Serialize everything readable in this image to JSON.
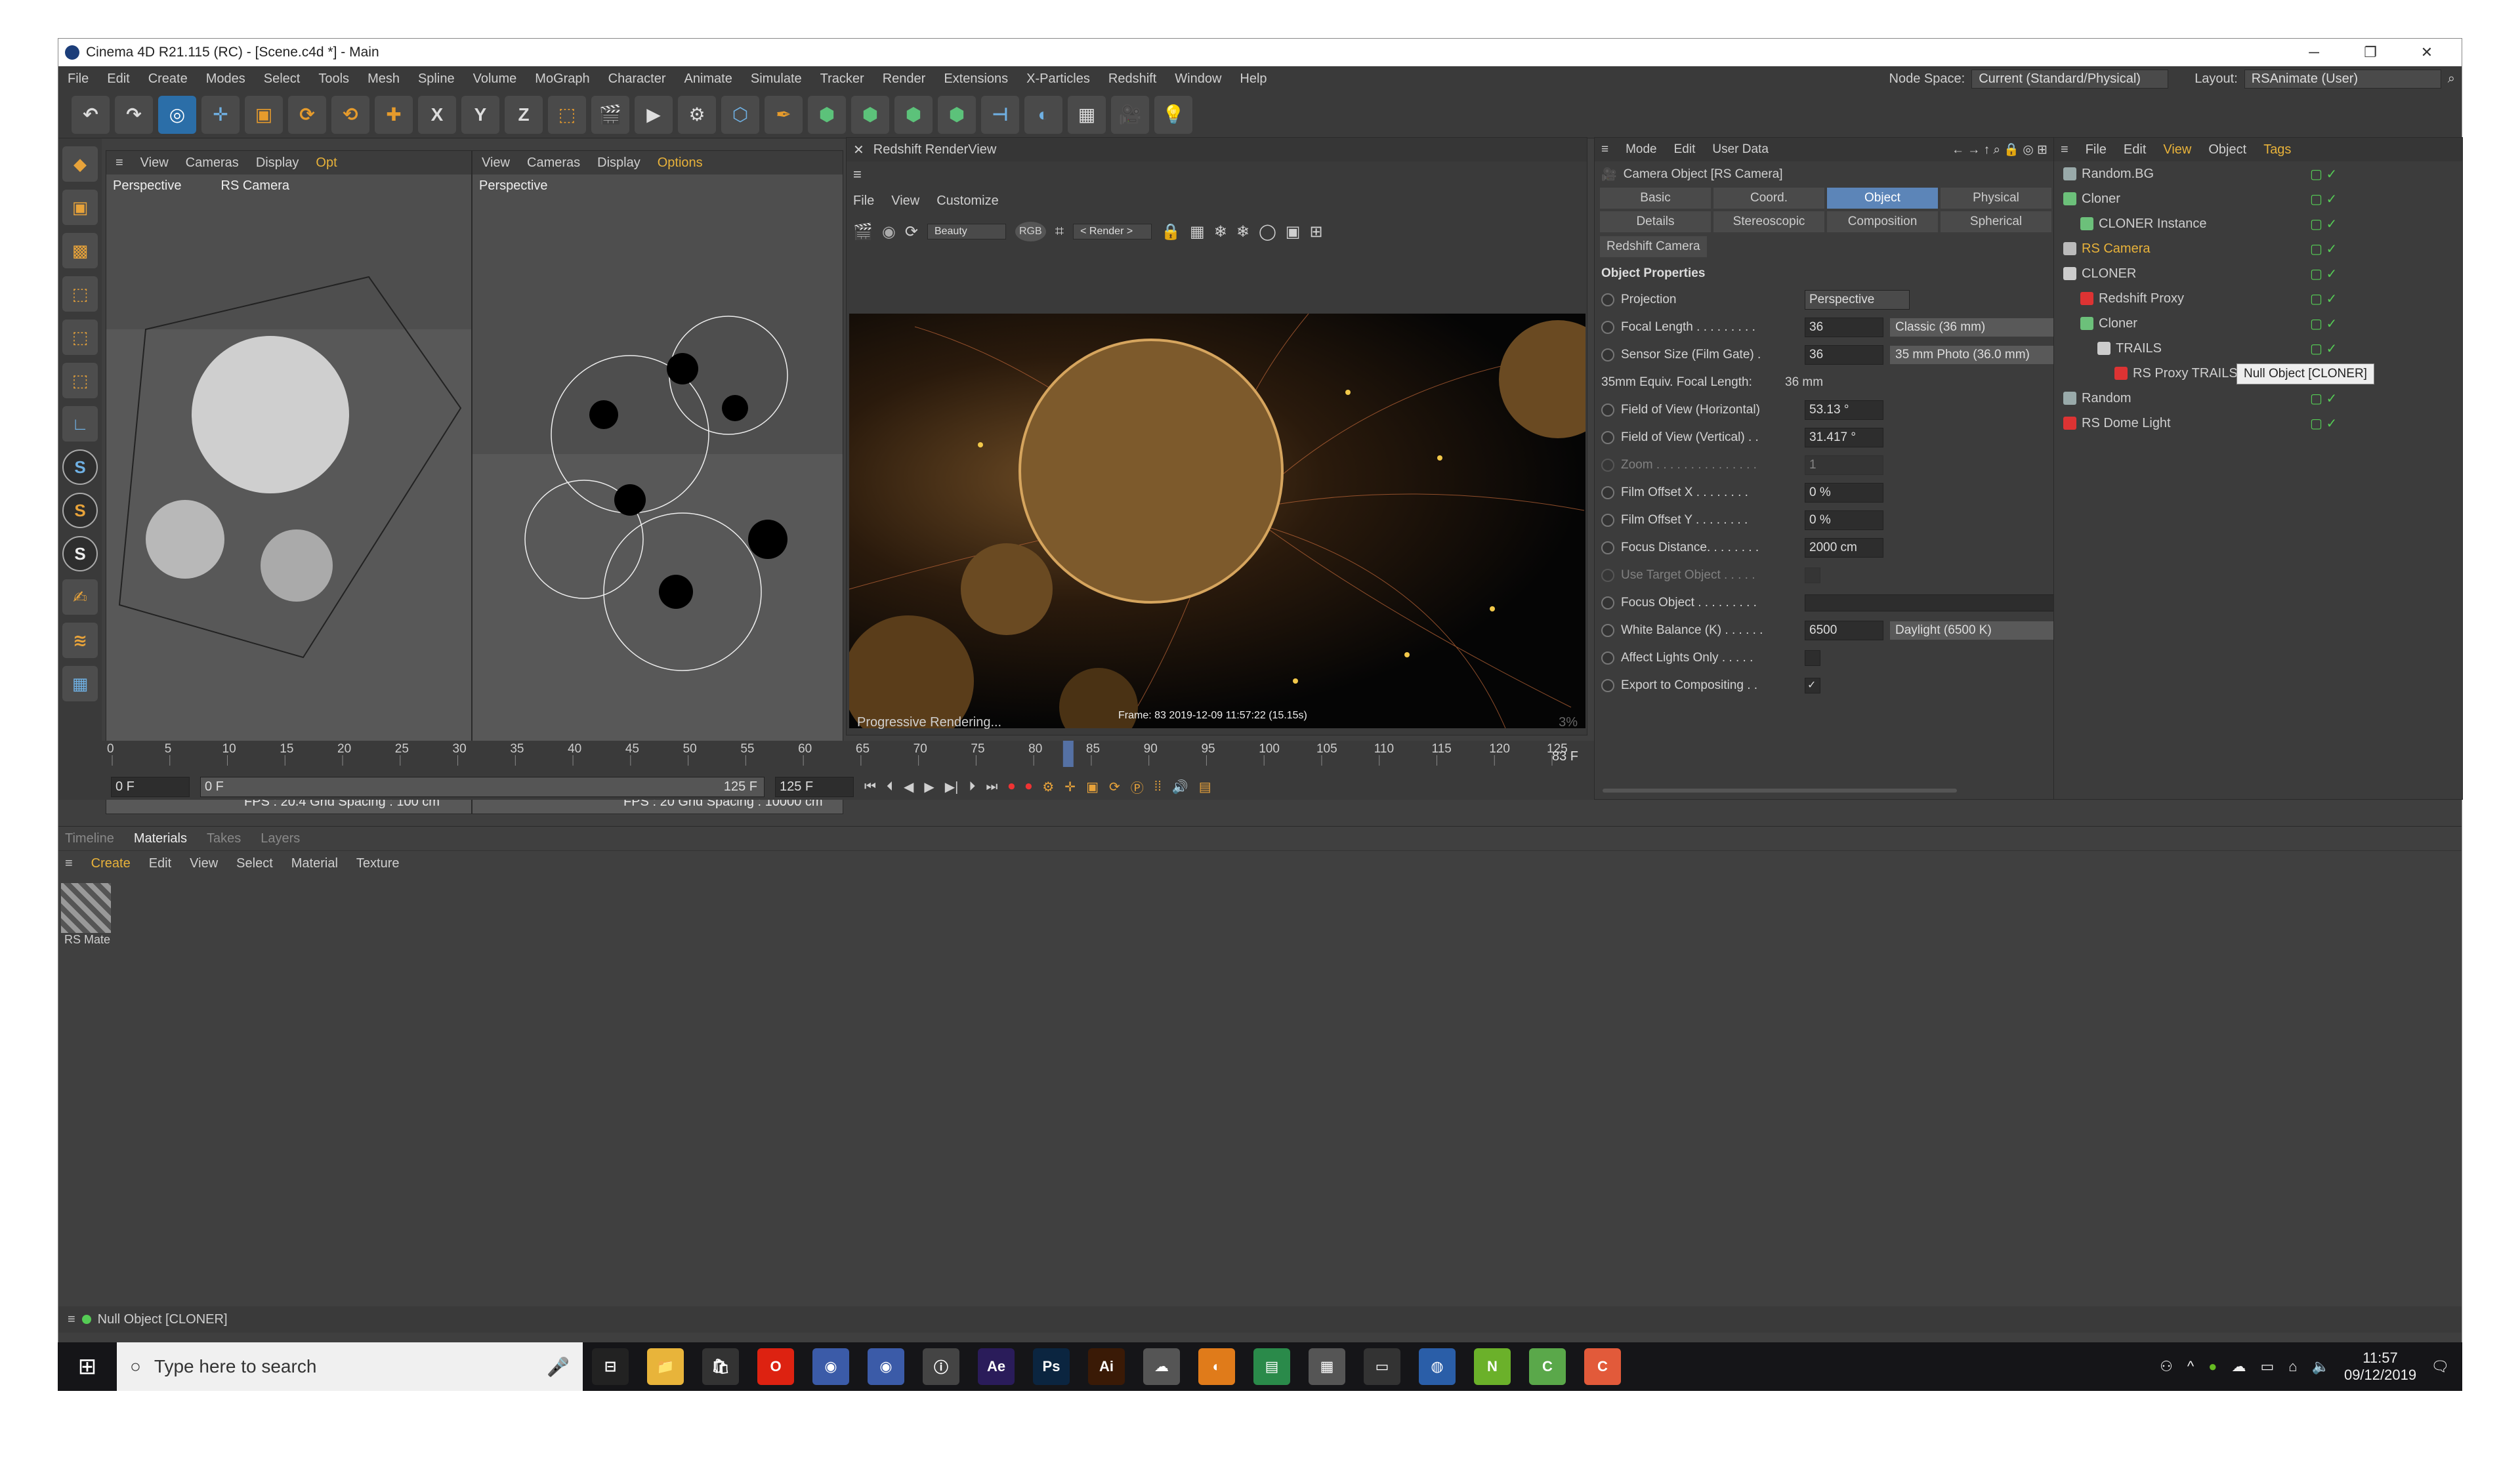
{
  "window": {
    "title": "Cinema 4D R21.115 (RC) - [Scene.c4d *] - Main",
    "controls": [
      "─",
      "❐",
      "✕"
    ]
  },
  "menubar": {
    "items": [
      "File",
      "Edit",
      "Create",
      "Modes",
      "Select",
      "Tools",
      "Mesh",
      "Spline",
      "Volume",
      "MoGraph",
      "Character",
      "Animate",
      "Simulate",
      "Tracker",
      "Render",
      "Extensions",
      "X-Particles",
      "Redshift",
      "Window",
      "Help"
    ],
    "node_space_label": "Node Space:",
    "node_space_value": "Current (Standard/Physical)",
    "layout_label": "Layout:",
    "layout_value": "RSAnimate (User)"
  },
  "toolbar": {
    "icons": [
      "undo-icon",
      "redo-icon",
      "live-select-icon",
      "move-icon",
      "scale-icon",
      "rotate-icon",
      "recent-icon",
      "axis-icon",
      "x-lock-icon",
      "y-lock-icon",
      "z-lock-icon",
      "coord-icon",
      "render-region-icon",
      "render-view-icon",
      "render-settings-icon",
      "cube-icon",
      "pen-icon",
      "subdivision-icon",
      "cloner-icon",
      "deformer-icon",
      "mograph-icon",
      "field-icon",
      "spline-icon",
      "floor-icon",
      "camera-icon",
      "light-icon"
    ],
    "glyphs": [
      "↶",
      "↷",
      "◎",
      "✛",
      "▣",
      "⟳",
      "⟲",
      "✚",
      "X",
      "Y",
      "Z",
      "⬚",
      "🎬",
      "▶",
      "⚙",
      "⬡",
      "✒",
      "⬢",
      "⬢",
      "⬢",
      "⬢",
      "⊣",
      "◐",
      "▦",
      "🎥",
      "💡"
    ]
  },
  "viewport1": {
    "menu": [
      "View",
      "Cameras",
      "Display",
      "Opt"
    ],
    "label": "Perspective",
    "camera": "RS Camera",
    "fps": "FPS : 20.4",
    "grid": "Grid Spacing : 100 cm"
  },
  "viewport2": {
    "menu": [
      "View",
      "Cameras",
      "Display",
      "Options"
    ],
    "label": "Perspective",
    "fps": "FPS : 20",
    "grid": "Grid Spacing : 10000 cm"
  },
  "renderview": {
    "title": "Redshift RenderView",
    "menu": [
      "File",
      "View",
      "Customize"
    ],
    "beauty": "Beauty",
    "rgb": "RGB",
    "render_dd": "< Render >",
    "frame_info": "Frame: 83   2019-12-09  11:57:22  (15.15s)",
    "progress_text": "Progressive Rendering...",
    "progress_pct": "3%"
  },
  "attributes": {
    "menu": [
      "Mode",
      "Edit",
      "User Data"
    ],
    "object_title": "Camera Object [RS Camera]",
    "tabs_row1": [
      "Basic",
      "Coord.",
      "Object",
      "Physical"
    ],
    "tabs_row2": [
      "Details",
      "Stereoscopic",
      "Composition",
      "Spherical"
    ],
    "active_tab": "Object",
    "extra_tab": "Redshift Camera",
    "section": "Object Properties",
    "props": [
      {
        "label": "Projection",
        "value": "Perspective",
        "type": "dropdown"
      },
      {
        "label": "Focal Length . . . . . . . . .",
        "value": "36",
        "extra": "Classic (36 mm)"
      },
      {
        "label": "Sensor Size (Film Gate) .",
        "value": "36",
        "extra": "35 mm Photo (36.0 mm)"
      },
      {
        "label": "35mm Equiv. Focal Length:",
        "value": "36 mm",
        "type": "text"
      },
      {
        "label": "Field of View (Horizontal)",
        "value": "53.13 °"
      },
      {
        "label": "Field of View (Vertical) . .",
        "value": "31.417 °"
      },
      {
        "label": "Zoom . . . . . . . . . . . . . . .",
        "value": "1",
        "disabled": true
      },
      {
        "label": "Film Offset X . . . . . . . .",
        "value": "0 %"
      },
      {
        "label": "Film Offset Y . . . . . . . .",
        "value": "0 %"
      },
      {
        "label": "Focus Distance. . . . . . . .",
        "value": "2000 cm"
      },
      {
        "label": "Use Target Object . . . . .",
        "value": "",
        "type": "check",
        "disabled": true
      },
      {
        "label": "Focus Object . . . . . . . . .",
        "value": "",
        "type": "link"
      },
      {
        "label": "White Balance (K) . . . . . .",
        "value": "6500",
        "extra": "Daylight (6500 K)"
      },
      {
        "label": "Affect Lights Only . . . . .",
        "value": "",
        "type": "check"
      },
      {
        "label": "Export to Compositing . .",
        "value": "✓",
        "type": "check"
      }
    ]
  },
  "objects": {
    "menu": [
      "File",
      "Edit",
      "View",
      "Object",
      "Tags"
    ],
    "items": [
      {
        "name": "Random.BG",
        "indent": 0,
        "color": "#cfcfcf",
        "icon": "#9aa"
      },
      {
        "name": "Cloner",
        "indent": 0,
        "color": "#cfcfcf",
        "icon": "#6cc07a"
      },
      {
        "name": "CLONER Instance",
        "indent": 1,
        "color": "#cfcfcf",
        "icon": "#6cc07a"
      },
      {
        "name": "RS Camera",
        "indent": 0,
        "color": "#e8b23a",
        "icon": "#bbb"
      },
      {
        "name": "CLONER",
        "indent": 0,
        "color": "#cfcfcf",
        "icon": "#ccc"
      },
      {
        "name": "Redshift Proxy",
        "indent": 1,
        "color": "#cfcfcf",
        "icon": "#d33"
      },
      {
        "name": "Cloner",
        "indent": 1,
        "color": "#cfcfcf",
        "icon": "#6cc07a"
      },
      {
        "name": "TRAILS",
        "indent": 2,
        "color": "#cfcfcf",
        "icon": "#ccc"
      },
      {
        "name": "RS Proxy TRAILSTRAILS01_",
        "indent": 3,
        "color": "#cfcfcf",
        "icon": "#d33"
      },
      {
        "name": "Random",
        "indent": 0,
        "color": "#cfcfcf",
        "icon": "#9aa"
      },
      {
        "name": "RS Dome Light",
        "indent": 0,
        "color": "#cfcfcf",
        "icon": "#d33"
      }
    ],
    "tooltip": "Null Object [CLONER]"
  },
  "timeline": {
    "ticks": [
      "0",
      "5",
      "10",
      "15",
      "20",
      "25",
      "30",
      "35",
      "40",
      "45",
      "50",
      "55",
      "60",
      "65",
      "70",
      "75",
      "80",
      "85",
      "90",
      "95",
      "100",
      "105",
      "110",
      "115",
      "120",
      "125"
    ],
    "current": "83 F",
    "start": "0 F",
    "start2": "0 F",
    "end": "125 F",
    "end2": "125 F",
    "playhead_frame": 83,
    "range_end": 125
  },
  "bottom": {
    "tabs": [
      "Timeline",
      "Materials",
      "Takes",
      "Layers"
    ],
    "active": "Materials",
    "menu": [
      "Create",
      "Edit",
      "View",
      "Select",
      "Material",
      "Texture"
    ],
    "material": "RS Mate"
  },
  "status": {
    "text": "Null Object [CLONER]"
  },
  "taskbar": {
    "search": "Type here to search",
    "time": "11:57",
    "date": "09/12/2019",
    "apps": [
      {
        "g": "⊟",
        "c": "#222"
      },
      {
        "g": "📁",
        "c": "#e8b43a"
      },
      {
        "g": "🛍",
        "c": "#333"
      },
      {
        "g": "O",
        "c": "#d21"
      },
      {
        "g": "◉",
        "c": "#3b5ba8"
      },
      {
        "g": "◉",
        "c": "#3b5ba8"
      },
      {
        "g": "ⓘ",
        "c": "#444"
      },
      {
        "g": "Ae",
        "c": "#2a1c5a"
      },
      {
        "g": "Ps",
        "c": "#0b2540"
      },
      {
        "g": "Ai",
        "c": "#3a1a06"
      },
      {
        "g": "☁",
        "c": "#555"
      },
      {
        "g": "◐",
        "c": "#e07b1a"
      },
      {
        "g": "▤",
        "c": "#2a8a4a"
      },
      {
        "g": "▦",
        "c": "#555"
      },
      {
        "g": "▭",
        "c": "#333"
      },
      {
        "g": "◍",
        "c": "#2a5ea8"
      },
      {
        "g": "N",
        "c": "#6bb12a"
      },
      {
        "g": "C",
        "c": "#5aa84a"
      },
      {
        "g": "C",
        "c": "#e25a3a"
      }
    ]
  }
}
